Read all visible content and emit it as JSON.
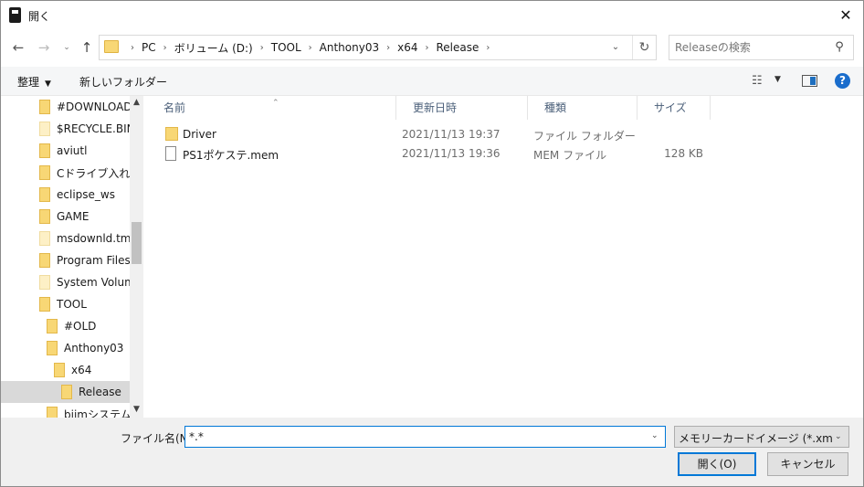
{
  "window": {
    "title": "開く",
    "close": "✕"
  },
  "address": {
    "crumbs": [
      "PC",
      "ボリューム (D:)",
      "TOOL",
      "Anthony03",
      "x64",
      "Release"
    ],
    "separator": "›"
  },
  "search": {
    "placeholder": "Releaseの検索"
  },
  "toolbar": {
    "organize": "整理",
    "new_folder": "新しいフォルダー"
  },
  "nav_tree": [
    {
      "label": "#DOWNLOAD",
      "indent": 0,
      "pale": false,
      "selected": false
    },
    {
      "label": "$RECYCLE.BIN",
      "indent": 0,
      "pale": true,
      "selected": false
    },
    {
      "label": "aviutl",
      "indent": 0,
      "pale": false,
      "selected": false
    },
    {
      "label": "Cドライブ入れ替え",
      "indent": 0,
      "pale": false,
      "selected": false
    },
    {
      "label": "eclipse_ws",
      "indent": 0,
      "pale": false,
      "selected": false
    },
    {
      "label": "GAME",
      "indent": 0,
      "pale": false,
      "selected": false
    },
    {
      "label": "msdownld.tmp",
      "indent": 0,
      "pale": true,
      "selected": false
    },
    {
      "label": "Program Files",
      "indent": 0,
      "pale": false,
      "selected": false
    },
    {
      "label": "System Volume",
      "indent": 0,
      "pale": true,
      "selected": false
    },
    {
      "label": "TOOL",
      "indent": 0,
      "pale": false,
      "selected": false
    },
    {
      "label": "#OLD",
      "indent": 1,
      "pale": false,
      "selected": false
    },
    {
      "label": "Anthony03",
      "indent": 1,
      "pale": false,
      "selected": false
    },
    {
      "label": "x64",
      "indent": 2,
      "pale": false,
      "selected": false
    },
    {
      "label": "Release",
      "indent": 3,
      "pale": false,
      "selected": true
    },
    {
      "label": "biimシステム",
      "indent": 1,
      "pale": false,
      "selected": false
    }
  ],
  "columns": {
    "name": "名前",
    "date": "更新日時",
    "type": "種類",
    "size": "サイズ"
  },
  "files": [
    {
      "name": "Driver",
      "date": "2021/11/13 19:37",
      "type": "ファイル フォルダー",
      "size": "",
      "kind": "folder"
    },
    {
      "name": "PS1ポケステ.mem",
      "date": "2021/11/13 19:36",
      "type": "MEM ファイル",
      "size": "128 KB",
      "kind": "file"
    }
  ],
  "bottom": {
    "filename_label": "ファイル名(N):",
    "filename_value": "*.*",
    "filetype": "メモリーカードイメージ (*.xmc,*.mem)",
    "open_button": "開く(O)",
    "cancel_button": "キャンセル"
  }
}
